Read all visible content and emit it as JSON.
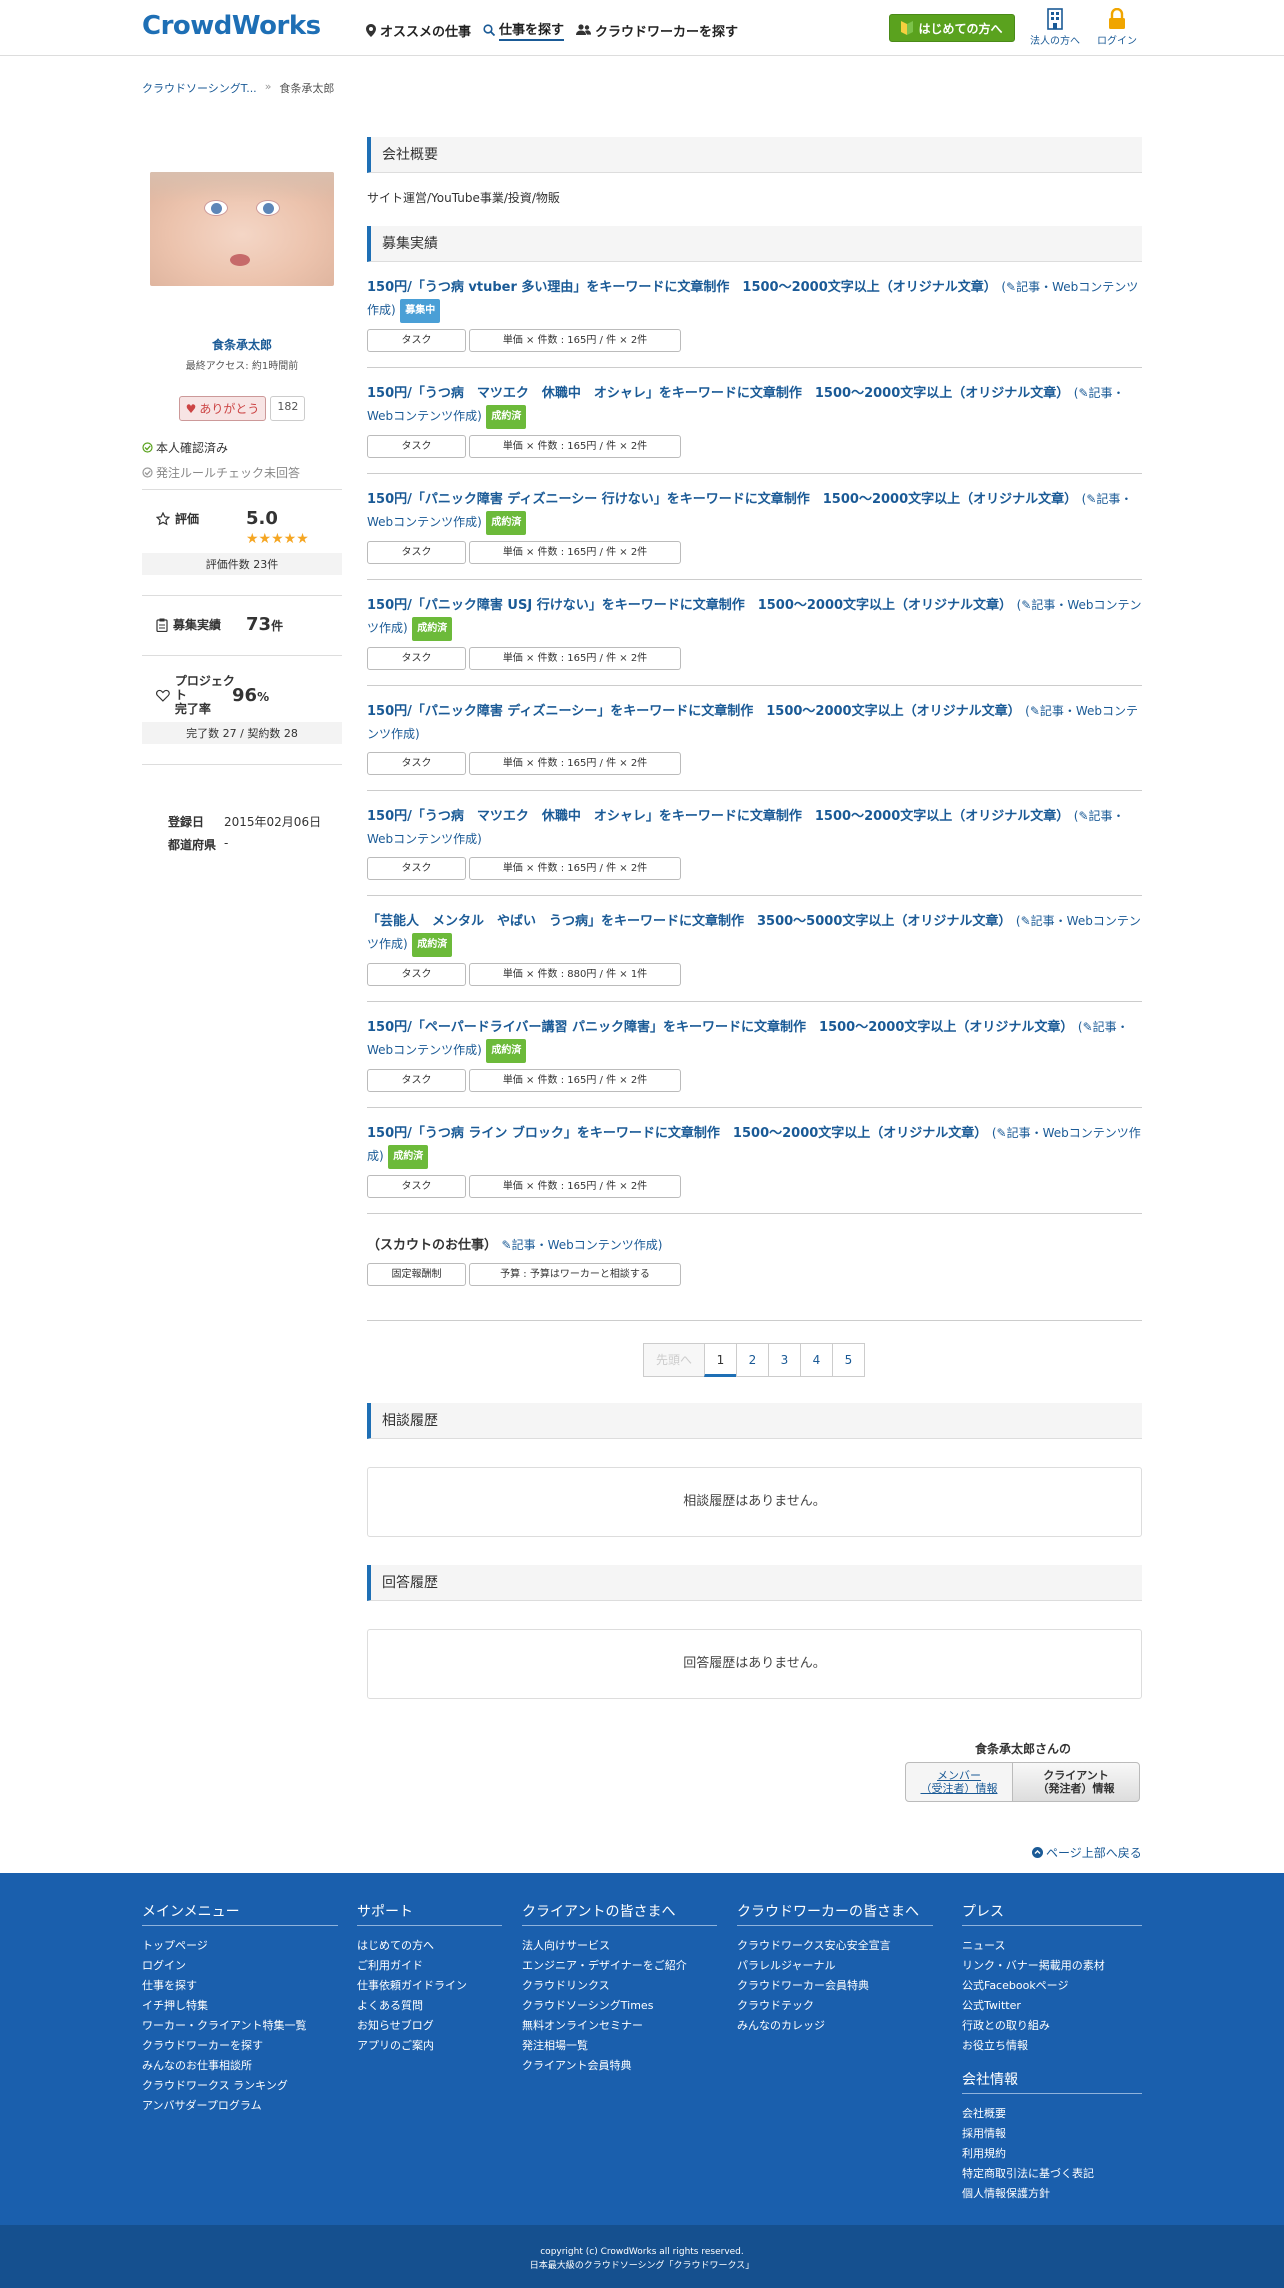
{
  "header": {
    "logo": "CrowdWorks",
    "nav": [
      "オススメの仕事",
      "仕事を探す",
      "クラウドワーカーを探す"
    ],
    "first_btn": "はじめての方へ",
    "corp_label": "法人の方へ",
    "login_label": "ログイン"
  },
  "breadcrumb": [
    "クラウドソーシングT...",
    "食条承太郎"
  ],
  "profile": {
    "name": "食条承太郎",
    "last_access": "最終アクセス: 約1時間前",
    "thanks_label": "ありがとう",
    "thanks_count": "182",
    "verified": "本人確認済み",
    "rule_check": "発注ルールチェック未回答",
    "rating_label": "評価",
    "rating_value": "5.0",
    "rating_stars": 5,
    "rating_count": "評価件数 23件",
    "jobs_label": "募集実績",
    "jobs_value": "73",
    "jobs_unit": "件",
    "completion_label1": "プロジェクト",
    "completion_label2": "完了率",
    "completion_value": "96",
    "completion_unit": "%",
    "completion_detail": "完了数 27 / 契約数 28",
    "registered_label": "登録日",
    "registered_value": "2015年02月06日",
    "pref_label": "都道府県",
    "pref_value": "-"
  },
  "main": {
    "company_header": "会社概要",
    "company_desc": "サイト運営/YouTube事業/投資/物販",
    "jobs_header": "募集実績",
    "jobs": [
      {
        "title": "150円/「うつ病 vtuber 多い理由」をキーワードに文章制作　1500〜2000文字以上（オリジナル文章）",
        "category": "記事・Webコンテンツ作成",
        "badge": "募集中",
        "badge_color": "blue",
        "type": "タスク",
        "price": "単価 × 件数 : 165円 / 件 × 2件"
      },
      {
        "title": "150円/「うつ病　マツエク　休職中　オシャレ」をキーワードに文章制作　1500〜2000文字以上（オリジナル文章）",
        "category": "記事・Webコンテンツ作成",
        "badge": "成約済",
        "badge_color": "green",
        "type": "タスク",
        "price": "単価 × 件数 : 165円 / 件 × 2件"
      },
      {
        "title": "150円/「パニック障害 ディズニーシー 行けない」をキーワードに文章制作　1500〜2000文字以上（オリジナル文章）",
        "category": "記事・Webコンテンツ作成",
        "badge": "成約済",
        "badge_color": "green",
        "type": "タスク",
        "price": "単価 × 件数 : 165円 / 件 × 2件"
      },
      {
        "title": "150円/「パニック障害 USJ 行けない」をキーワードに文章制作　1500〜2000文字以上（オリジナル文章）",
        "category": "記事・Webコンテンツ作成",
        "badge": "成約済",
        "badge_color": "green",
        "type": "タスク",
        "price": "単価 × 件数 : 165円 / 件 × 2件"
      },
      {
        "title": "150円/「パニック障害 ディズニーシー」をキーワードに文章制作　1500〜2000文字以上（オリジナル文章）",
        "category": "記事・Webコンテンツ作成",
        "badge": "",
        "badge_color": "green",
        "type": "タスク",
        "price": "単価 × 件数 : 165円 / 件 × 2件"
      },
      {
        "title": "150円/「うつ病　マツエク　休職中　オシャレ」をキーワードに文章制作　1500〜2000文字以上（オリジナル文章）",
        "category": "記事・Webコンテンツ作成",
        "badge": "",
        "badge_color": "green",
        "type": "タスク",
        "price": "単価 × 件数 : 165円 / 件 × 2件"
      },
      {
        "title": "「芸能人　メンタル　やばい　うつ病」をキーワードに文章制作　3500〜5000文字以上（オリジナル文章）",
        "category": "記事・Webコンテンツ作成",
        "badge": "成約済",
        "badge_color": "green",
        "type": "タスク",
        "price": "単価 × 件数 : 880円 / 件 × 1件"
      },
      {
        "title": "150円/「ペーパードライバー講習 パニック障害」をキーワードに文章制作　1500〜2000文字以上（オリジナル文章）",
        "category": "記事・Webコンテンツ作成",
        "badge": "成約済",
        "badge_color": "green",
        "type": "タスク",
        "price": "単価 × 件数 : 165円 / 件 × 2件"
      },
      {
        "title": "150円/「うつ病 ライン ブロック」をキーワードに文章制作　1500〜2000文字以上（オリジナル文章）",
        "category": "記事・Webコンテンツ作成",
        "badge": "成約済",
        "badge_color": "green",
        "type": "タスク",
        "price": "単価 × 件数 : 165円 / 件 × 2件"
      }
    ],
    "scout": {
      "title": "（スカウトのお仕事）",
      "category": "記事・Webコンテンツ作成",
      "type": "固定報酬制",
      "price": "予算 : 予算はワーカーと相談する"
    },
    "pager": {
      "prev": "先頭へ",
      "pages": [
        "1",
        "2",
        "3",
        "4",
        "5"
      ],
      "current": "1"
    },
    "consult_header": "相談履歴",
    "consult_empty": "相談履歴はありません。",
    "answer_header": "回答履歴",
    "answer_empty": "回答履歴はありません。",
    "member_title": "食条承太郎さんの",
    "member_tab1_l1": "メンバー",
    "member_tab1_l2": "（受注者）情報",
    "member_tab2_l1": "クライアント",
    "member_tab2_l2": "（発注者）情報",
    "pagetop": "ページ上部へ戻る"
  },
  "footer": {
    "cols": [
      {
        "title": "メインメニュー",
        "items": [
          "トップページ",
          "ログイン",
          "仕事を探す",
          "イチ押し特集",
          "ワーカー・クライアント特集一覧",
          "クラウドワーカーを探す",
          "みんなのお仕事相談所",
          "クラウドワークス ランキング",
          "アンバサダープログラム"
        ]
      },
      {
        "title": "サポート",
        "items": [
          "はじめての方へ",
          "ご利用ガイド",
          "仕事依頼ガイドライン",
          "よくある質問",
          "お知らせブログ",
          "アプリのご案内"
        ]
      },
      {
        "title": "クライアントの皆さまへ",
        "items": [
          "法人向けサービス",
          "エンジニア・デザイナーをご紹介",
          "クラウドリンクス",
          "クラウドソーシングTimes",
          "無料オンラインセミナー",
          "発注相場一覧",
          "クライアント会員特典"
        ]
      },
      {
        "title": "クラウドワーカーの皆さまへ",
        "items": [
          "クラウドワークス安心安全宣言",
          "パラレルジャーナル",
          "クラウドワーカー会員特典",
          "クラウドテック",
          "みんなのカレッジ"
        ]
      },
      {
        "title": "プレス",
        "items": [
          "ニュース",
          "リンク・バナー掲載用の素材",
          "公式Facebookページ",
          "公式Twitter",
          "行政との取り組み",
          "お役立ち情報"
        ]
      },
      {
        "title": "会社情報",
        "items": [
          "会社概要",
          "採用情報",
          "利用規約",
          "特定商取引法に基づく表記",
          "個人情報保護方針"
        ]
      }
    ],
    "copyright": "copyright (c) CrowdWorks all rights reserved.",
    "tagline": "日本最大級のクラウドソーシング「クラウドワークス」"
  },
  "colors": {
    "brand": "#1e6fb5",
    "footer": "#1a5fad",
    "cta": "#5aa21e"
  }
}
